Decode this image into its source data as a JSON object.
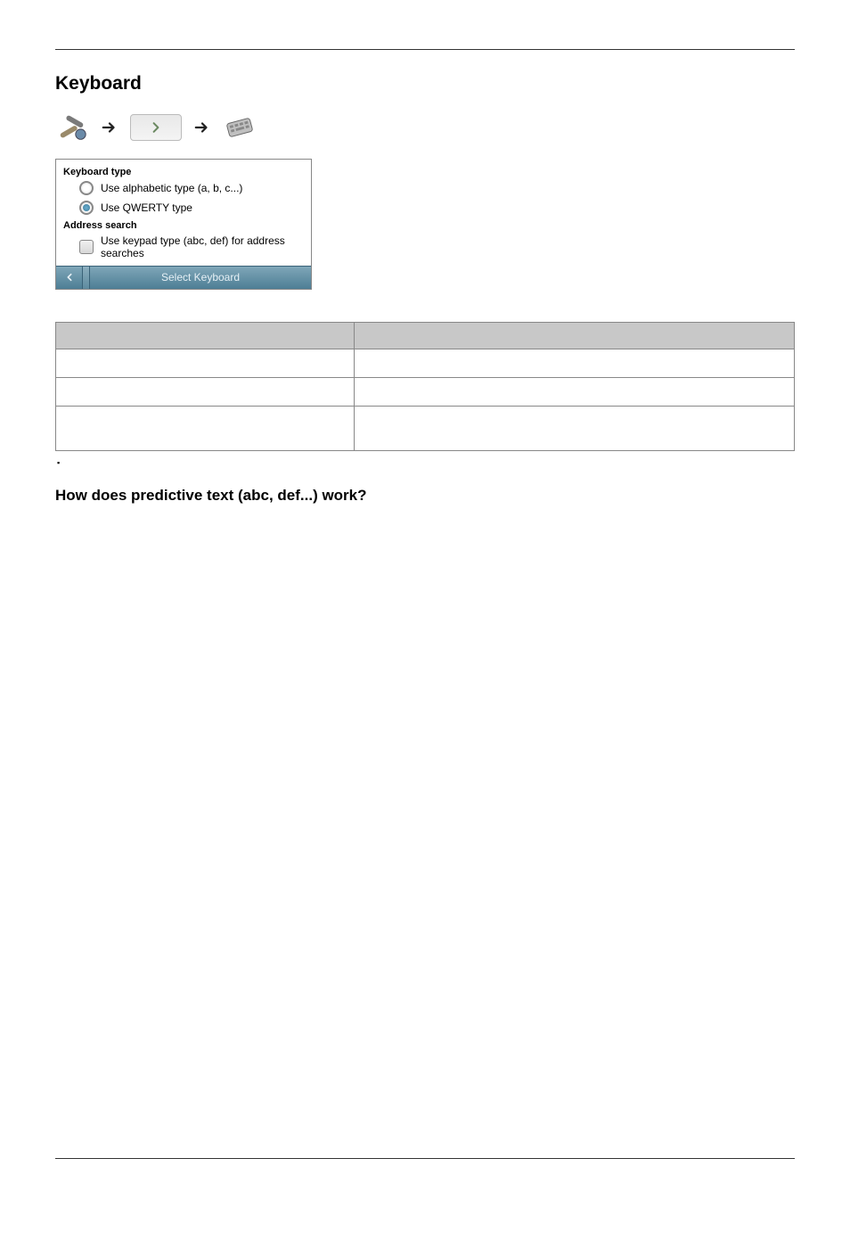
{
  "heading1": "Keyboard",
  "heading2": "How does predictive text (abc, def...) work?",
  "panel": {
    "section1": "Keyboard type",
    "opt_alpha": "Use alphabetic type (a, b, c...)",
    "opt_qwerty": "Use QWERTY type",
    "section2": "Address search",
    "opt_keypad": "Use keypad type (abc, def) for address searches",
    "footer_label": "Select Keyboard"
  },
  "table": {
    "h0": "",
    "h1": "",
    "rows": [
      [
        "",
        ""
      ],
      [
        "",
        ""
      ],
      [
        "",
        ""
      ]
    ]
  },
  "bullet": "▪"
}
